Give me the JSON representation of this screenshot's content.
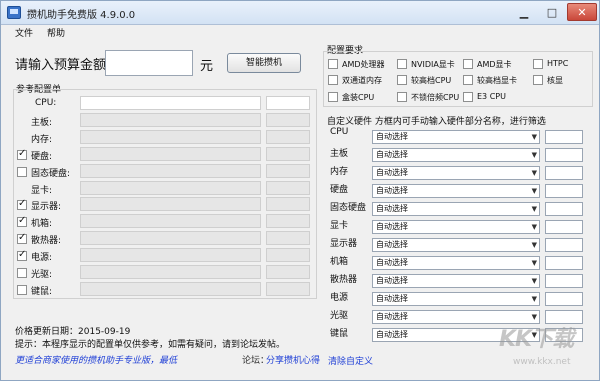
{
  "window": {
    "title": "攒机助手免费版 4.9.0.0"
  },
  "menu": {
    "file": "文件",
    "help": "帮助"
  },
  "budget": {
    "label": "请输入预算金额",
    "value": "",
    "unit": "元",
    "button": "智能攒机"
  },
  "reference": {
    "title": "参考配置单",
    "rows": [
      {
        "label": "CPU:",
        "checkbox": false,
        "checked": false
      },
      {
        "label": "主板:",
        "checkbox": false,
        "checked": false
      },
      {
        "label": "内存:",
        "checkbox": false,
        "checked": false
      },
      {
        "label": "硬盘:",
        "checkbox": true,
        "checked": true
      },
      {
        "label": "固态硬盘:",
        "checkbox": true,
        "checked": false
      },
      {
        "label": "显卡:",
        "checkbox": false,
        "checked": false
      },
      {
        "label": "显示器:",
        "checkbox": true,
        "checked": true
      },
      {
        "label": "机箱:",
        "checkbox": true,
        "checked": true
      },
      {
        "label": "散热器:",
        "checkbox": true,
        "checked": true
      },
      {
        "label": "电源:",
        "checkbox": true,
        "checked": true
      },
      {
        "label": "光驱:",
        "checkbox": true,
        "checked": false
      },
      {
        "label": "键鼠:",
        "checkbox": true,
        "checked": false
      }
    ]
  },
  "config_requirements": {
    "title": "配置要求",
    "options": [
      [
        "AMD处理器",
        "NVIDIA显卡",
        "AMD显卡",
        "HTPC"
      ],
      [
        "双通道内存",
        "较高档CPU",
        "较高档显卡",
        "核显"
      ],
      [
        "盒装CPU",
        "不锁倍频CPU",
        "E3 CPU"
      ]
    ]
  },
  "custom": {
    "title": "自定义硬件 方框内可手动输入硬件部分名称，进行筛选",
    "default_option": "自动选择",
    "rows": [
      "CPU",
      "主板",
      "内存",
      "硬盘",
      "固态硬盘",
      "显卡",
      "显示器",
      "机箱",
      "散热器",
      "电源",
      "光驱",
      "键鼠"
    ],
    "clear_label": "清除自定义"
  },
  "footer": {
    "date_label": "价格更新日期：",
    "date": "2015-09-19",
    "tip": "提示：本程序显示的配置单仅供参考，如需有疑问，请到论坛发帖。",
    "promo": "更适合商家使用的攒机助手专业版，最低",
    "forum_label": "论坛：",
    "forum_link": "分享攒机心得"
  },
  "watermark": {
    "brand": "KK下载",
    "url": "www.kkx.net"
  }
}
